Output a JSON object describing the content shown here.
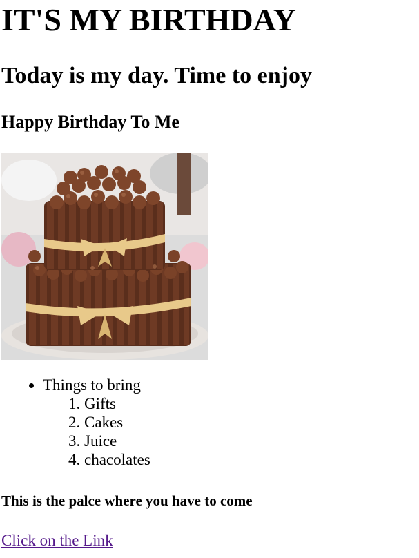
{
  "heading_main": "IT'S MY BIRTHDAY",
  "heading_sub": "Today is my day. Time to enjoy",
  "heading_small": "Happy Birthday To Me",
  "image": {
    "subject": "chocolate-cake"
  },
  "list": {
    "item": "Things to bring",
    "subitems": [
      "Gifts",
      "Cakes",
      "Juice",
      "chacolates"
    ]
  },
  "place_text": "This is the palce where you have to come",
  "link_text": "Click on the Link",
  "colors": {
    "link_visited": "#551a8b",
    "cake_chocolate": "#5a2e1c",
    "ribbon": "#e8c98a"
  }
}
